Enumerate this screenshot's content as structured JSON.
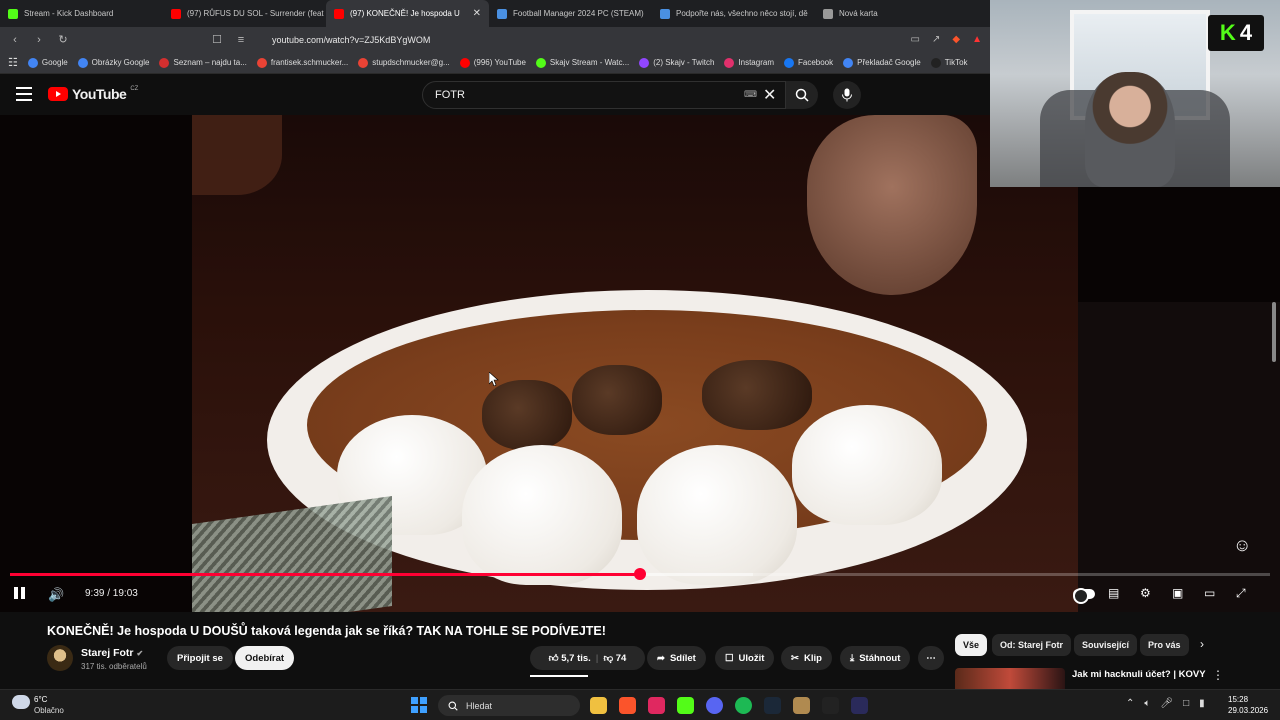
{
  "browser": {
    "tabs": [
      {
        "title": "Stream - Kick Dashboard",
        "color": "#53fc18"
      },
      {
        "title": "(97) RŮFUS DU SOL - Surrender (feat",
        "color": "#ff0000"
      },
      {
        "title": "(97) KONEČNĚ! Je hospoda U",
        "color": "#ff0000",
        "active": true
      },
      {
        "title": "Football Manager 2024 PC (STEAM)",
        "color": "#4a90e2"
      },
      {
        "title": "Podpořte nás, všechno něco stojí, dě",
        "color": "#4a90e2"
      },
      {
        "title": "Nová karta",
        "color": "#999999"
      }
    ],
    "url": "youtube.com/watch?v=ZJ5KdBYgWOM",
    "bookmarks": [
      {
        "label": "Google",
        "color": "#4285f4"
      },
      {
        "label": "Obrázky Google",
        "color": "#4285f4"
      },
      {
        "label": "Seznam – najdu ta...",
        "color": "#d32f2f"
      },
      {
        "label": "frantisek.schmucker...",
        "color": "#ea4335"
      },
      {
        "label": "stupdschmucker@g...",
        "color": "#ea4335"
      },
      {
        "label": "(996) YouTube",
        "color": "#ff0000"
      },
      {
        "label": "Skajv Stream - Watc...",
        "color": "#53fc18"
      },
      {
        "label": "(2) Skajv - Twitch",
        "color": "#9146ff"
      },
      {
        "label": "Instagram",
        "color": "#e1306c"
      },
      {
        "label": "Facebook",
        "color": "#1877f2"
      },
      {
        "label": "Překladač Google",
        "color": "#4285f4"
      },
      {
        "label": "TikTok",
        "color": "#222222"
      }
    ]
  },
  "youtube": {
    "logo_text": "YouTube",
    "country_code": "CZ",
    "search_value": "FOTR",
    "accent": "#ff0033"
  },
  "player": {
    "time": "9:39 / 19:03",
    "progress_fraction": 0.5,
    "buffered_fraction": 0.59
  },
  "video": {
    "title": "KONEČNĚ! Je hospoda U DOUŠŮ taková legenda jak se říká? TAK NA TOHLE SE PODÍVEJTE!",
    "channel_name": "Starej Fotr",
    "subscribers": "317 tis. odběratelů",
    "join_label": "Připojit se",
    "unsubscribe_label": "Odebírat",
    "likes": "5,7 tis.",
    "dislikes": "74",
    "share_label": "Sdílet",
    "save_label": "Uložit",
    "clip_label": "Klip",
    "download_label": "Stáhnout"
  },
  "sidebar": {
    "chips": [
      "Vše",
      "Od: Starej Fotr",
      "Související",
      "Pro vás"
    ],
    "recommendation_title": "Jak mi hacknuli účet? | KOVY"
  },
  "overlay": {
    "badge_letter": "K",
    "badge_number": "4"
  },
  "taskbar": {
    "temperature": "6°C",
    "weather": "Oblačno",
    "search_placeholder": "Hledat",
    "time": "15:28",
    "date": "29.03.2026"
  }
}
